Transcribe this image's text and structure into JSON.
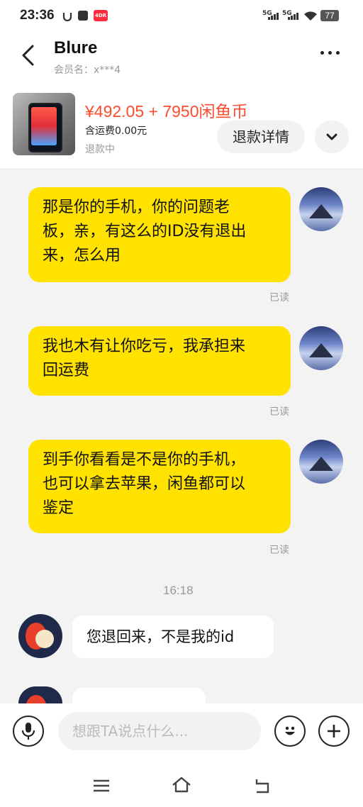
{
  "status_bar": {
    "time": "23:36",
    "net1": "5G",
    "net2": "5G",
    "battery": "77",
    "badge": "4DR"
  },
  "header": {
    "name": "Blure",
    "member": "会员名：x***4"
  },
  "product": {
    "price": "¥492.05 + 7950闲鱼币",
    "shipping": "含运费0.00元",
    "status": "退款中",
    "refund_button": "退款详情"
  },
  "messages": [
    {
      "side": "right",
      "text": "那是你的手机，你的问题老板，亲，有这么的ID没有退出来，怎么用",
      "lines": [
        "那是你的手机，你的问题老",
        "板，亲，有这么的ID没有退出",
        "来，怎么用"
      ],
      "read": "已读"
    },
    {
      "side": "right",
      "text": "我也木有让你吃亏，我承担来回运费",
      "lines": [
        "我也木有让你吃亏，我承担来",
        "回运费"
      ],
      "read": "已读"
    },
    {
      "side": "right",
      "text": "到手你看看是不是你的手机，也可以拿去苹果，闲鱼都可以鉴定",
      "lines": [
        "到手你看看是不是你的手机，",
        "也可以拿去苹果，闲鱼都可以",
        "鉴定"
      ],
      "read": "已读"
    }
  ],
  "timestamp": "16:18",
  "incoming": {
    "text": "您退回来，不是我的id"
  },
  "input": {
    "placeholder": "想跟TA说点什么..."
  },
  "icons": {
    "back": "back-arrow-icon",
    "more": "more-dots-icon",
    "voice": "microphone-icon",
    "emoji": "emoji-icon",
    "plus": "plus-icon",
    "expand": "chevron-down-icon"
  },
  "colors": {
    "bubble": "#ffe200",
    "price": "#ff4a2c"
  }
}
